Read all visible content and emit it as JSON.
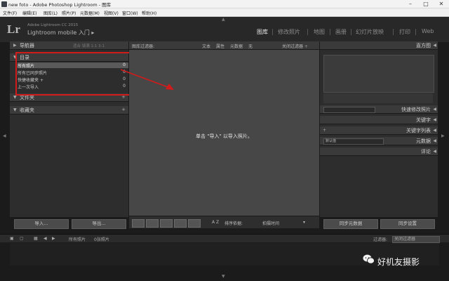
{
  "window": {
    "title": "new foto - Adobe Photoshop Lightroom - 图库",
    "minimize_icon": "minimize-icon",
    "maximize_icon": "maximize-icon",
    "close_icon": "close-icon"
  },
  "menu": [
    "文件(F)",
    "编辑(E)",
    "图库(L)",
    "照片(P)",
    "元数据(M)",
    "视图(V)",
    "窗口(W)",
    "帮助(H)"
  ],
  "identity": {
    "logo": "Lr",
    "brand_line1": "Adobe Lightroom CC 2015",
    "brand_line2": "Lightroom mobile 入门 ▸"
  },
  "modules": [
    "图库",
    "修改照片",
    "地图",
    "画册",
    "幻灯片放映",
    "打印",
    "Web"
  ],
  "active_module": "图库",
  "left_panel": {
    "navigator_label": "导航器",
    "navigator_zoom": "适合 填满 1:1 3:1",
    "catalog_label": "目录",
    "catalog_items": [
      {
        "label": "所有照片",
        "count": "0"
      },
      {
        "label": "所有已同步照片",
        "count": "0"
      },
      {
        "label": "快捷收藏夹 +",
        "count": "0"
      },
      {
        "label": "上一次导入",
        "count": "0"
      }
    ],
    "folders_label": "文件夹",
    "collections_label": "收藏夹",
    "add_icon": "plus-icon",
    "import_button": "导入...",
    "export_button": "导出..."
  },
  "filter_bar": {
    "label": "图库过滤器:",
    "text": "文本",
    "attribute": "属性",
    "metadata": "元数据",
    "none": "无",
    "preset": "关闭过滤器 ÷"
  },
  "grid": {
    "empty_message": "单击 \"导入\" 以导入照片。"
  },
  "toolbar": {
    "sort_label": "排序依据:",
    "sort_value": "拍摄时间",
    "view_icons": [
      "grid-view-icon",
      "loupe-view-icon",
      "compare-view-icon",
      "survey-view-icon",
      "people-view-icon"
    ],
    "az_label": "A Z"
  },
  "right_panel": {
    "histogram_label": "直方图",
    "quick_develop_label": "快速修改照片",
    "keywording_label": "关键字",
    "keyword_list_label": "关键字列表",
    "metadata_label": "元数据",
    "metadata_preset": "默认值",
    "comments_label": "评论",
    "sync_metadata_button": "同步元数据",
    "sync_settings_button": "同步设置"
  },
  "filmstrip": {
    "source": "所有照片",
    "count": "0张照片",
    "filter_label": "过滤器:",
    "filter_value": "关闭过滤器"
  },
  "watermark": "好机友摄影"
}
